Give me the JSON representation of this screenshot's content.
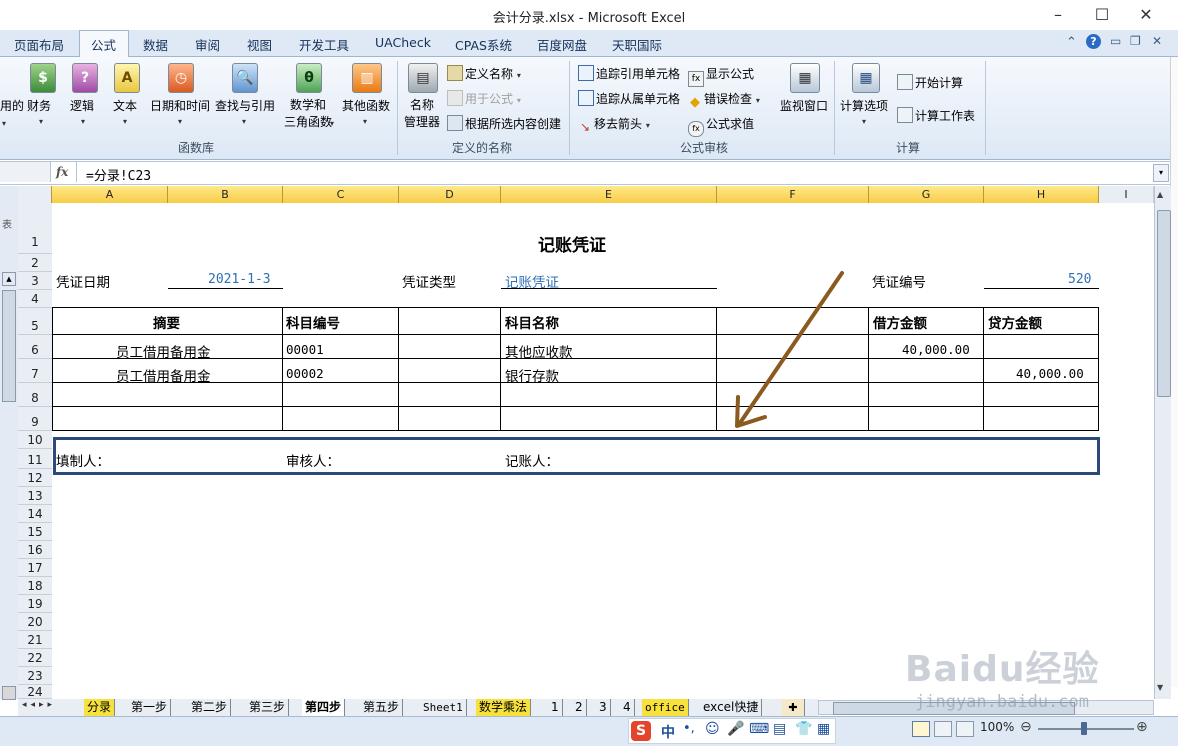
{
  "window": {
    "title": "会计分录.xlsx - Microsoft Excel"
  },
  "tabs": [
    "页面布局",
    "公式",
    "数据",
    "审阅",
    "视图",
    "开发工具",
    "UACheck",
    "CPAS系统",
    "百度网盘",
    "天职国际"
  ],
  "active_tab": "公式",
  "ribbon": {
    "function_library": {
      "label": "函数库",
      "cut_left": "用的",
      "buttons": [
        "财务",
        "逻辑",
        "文本",
        "日期和时间",
        "查找与引用",
        "数学和\n三角函数",
        "其他函数"
      ]
    },
    "defined_names": {
      "label": "定义的名称",
      "name_manager": "名称\n管理器",
      "define_name": "定义名称",
      "use_in_formula": "用于公式",
      "create_from_selection": "根据所选内容创建"
    },
    "formula_auditing": {
      "label": "公式审核",
      "trace_precedents": "追踪引用单元格",
      "trace_dependents": "追踪从属单元格",
      "remove_arrows": "移去箭头",
      "show_formulas": "显示公式",
      "error_checking": "错误检查",
      "evaluate_formula": "公式求值",
      "watch_window": "监视窗口"
    },
    "calculation": {
      "label": "计算",
      "calc_options": "计算选项",
      "calc_now": "开始计算",
      "calc_sheet": "计算工作表"
    }
  },
  "formula_bar": {
    "fx": "fx",
    "formula": "=分录!C23"
  },
  "columns": [
    "A",
    "B",
    "C",
    "D",
    "E",
    "F",
    "G",
    "H",
    "I"
  ],
  "rows": [
    "1",
    "2",
    "3",
    "4",
    "5",
    "6",
    "7",
    "8",
    "9",
    "10",
    "11",
    "12",
    "13",
    "14",
    "15",
    "16",
    "17",
    "18",
    "19",
    "20",
    "21",
    "22",
    "23",
    "24"
  ],
  "voucher": {
    "title": "记账凭证",
    "date_label": "凭证日期",
    "date_value": "2021-1-3",
    "type_label": "凭证类型",
    "type_value": "记账凭证",
    "number_label": "凭证编号",
    "number_value": "520",
    "headers": {
      "summary": "摘要",
      "account_code": "科目编号",
      "account_name": "科目名称",
      "debit": "借方金额",
      "credit": "贷方金额"
    },
    "entries": [
      {
        "summary": "员工借用备用金",
        "code": "00001",
        "name": "其他应收款",
        "debit": "40,000.00",
        "credit": ""
      },
      {
        "summary": "员工借用备用金",
        "code": "00002",
        "name": "银行存款",
        "debit": "",
        "credit": "40,000.00"
      }
    ],
    "prepared_by": "填制人：",
    "reviewed_by": "审核人：",
    "posted_by": "记账人："
  },
  "sheet_tabs": [
    "分录",
    "第一步",
    "第二步",
    "第三步",
    "第四步",
    "第五步",
    "Sheet1",
    "数学乘法",
    "1",
    "2",
    "3",
    "4",
    "office",
    "excel快捷"
  ],
  "active_sheet": "第四步",
  "status": {
    "zoom": "100%",
    "ime": "中",
    "watermark": "Baidu经验",
    "watermark_url": "jingyan.baidu.com"
  },
  "colors": {
    "title_blue": "#2f6fb5",
    "arrow": "#8b5a1e",
    "border_box": "#2b4a7a",
    "header_yellow": "#f7cc48"
  }
}
